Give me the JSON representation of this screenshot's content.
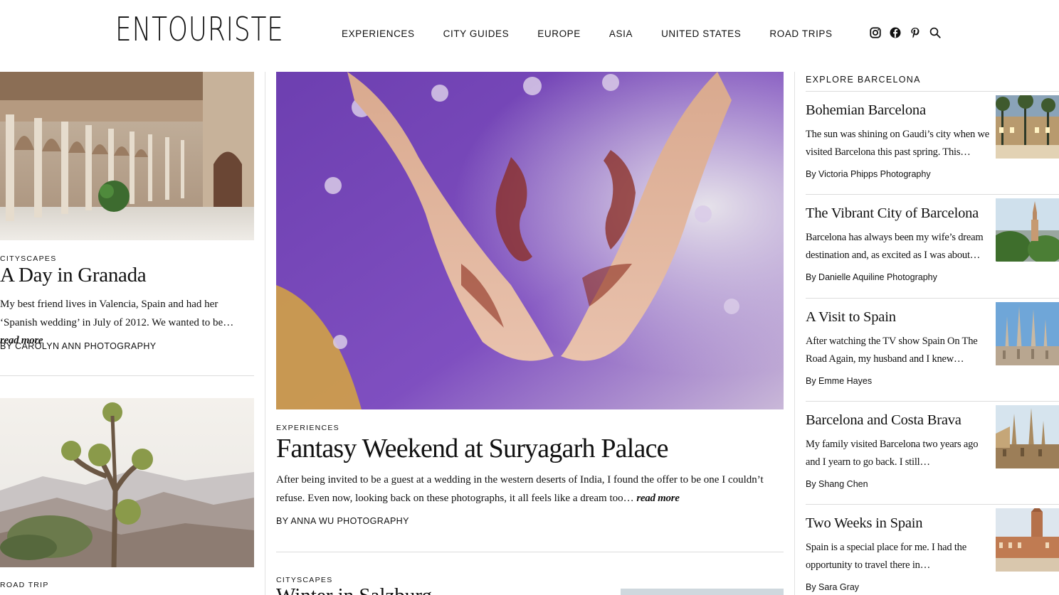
{
  "header": {
    "logo": "ENTOURISTE",
    "nav": [
      "EXPERIENCES",
      "CITY GUIDES",
      "EUROPE",
      "ASIA",
      "UNITED STATES",
      "ROAD TRIPS"
    ],
    "icons": [
      "instagram-icon",
      "facebook-icon",
      "pinterest-icon",
      "search-icon"
    ]
  },
  "left": {
    "post1": {
      "category": "CITYSCAPES",
      "title": "A Day in Granada",
      "excerpt": "My best friend lives in Valencia, Spain and had her ‘Spanish wedding’ in July of 2012. We wanted to be…",
      "read_more": "read more",
      "byline": "BY CAROLYN ANN PHOTOGRAPHY"
    },
    "post2": {
      "category": "ROAD TRIP"
    }
  },
  "center": {
    "featured": {
      "category": "EXPERIENCES",
      "title": "Fantasy Weekend at Suryagarh Palace",
      "excerpt": "After being invited to be a guest at a wedding in the western deserts of India, I found the offer to be one I couldn’t refuse. Even now, looking back on these photographs, it all feels like a dream too…",
      "read_more": "read more",
      "byline": "BY ANNA WU PHOTOGRAPHY"
    },
    "next": {
      "category": "CITYSCAPES",
      "title": "Winter in Salzburg"
    }
  },
  "sidebar": {
    "heading": "EXPLORE BARCELONA",
    "items": [
      {
        "title": "Bohemian Barcelona",
        "excerpt": "The sun was shining on Gaudi’s city when we visited Barcelona this past spring. This…",
        "byline": "By Victoria Phipps Photography"
      },
      {
        "title": "The Vibrant City of Barcelona",
        "excerpt": "Barcelona has always been my wife’s dream destination and, as excited as I was about…",
        "byline": "By Danielle Aquiline Photography"
      },
      {
        "title": "A Visit to Spain",
        "excerpt": "After watching the TV show Spain On The Road Again, my husband and I knew…",
        "byline": "By Emme Hayes"
      },
      {
        "title": "Barcelona and Costa Brava",
        "excerpt": "My family visited Barcelona two years ago and I yearn to go back. I still…",
        "byline": "By Shang Chen"
      },
      {
        "title": "Two Weeks in Spain",
        "excerpt": "Spain is a special place for me. I had the opportunity to travel there in…",
        "byline": "By Sara Gray"
      }
    ]
  },
  "colors": {
    "text": "#111111",
    "rule": "#dcdcdc",
    "background": "#ffffff"
  }
}
